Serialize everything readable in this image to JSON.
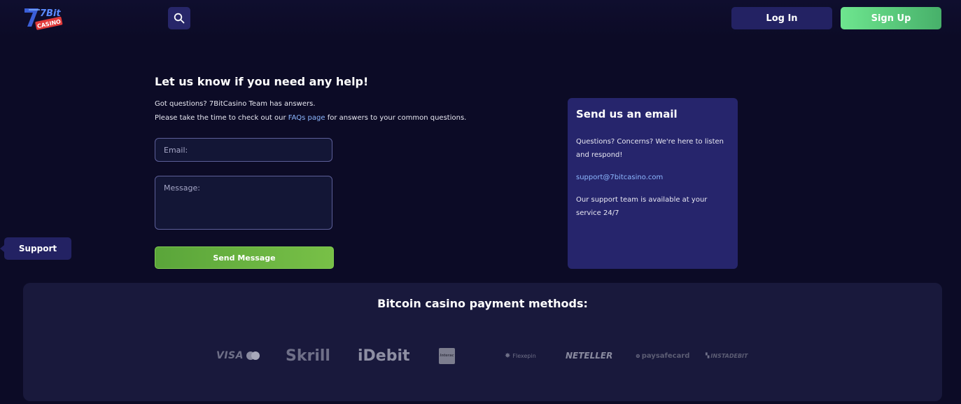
{
  "header": {
    "logo": {
      "text_top": "7Bit",
      "text_bottom": "CASINO",
      "icon": "7bit-casino-logo-icon"
    },
    "search_icon": "search-icon",
    "login_label": "Log In",
    "signup_label": "Sign Up"
  },
  "help": {
    "title": "Let us know if you need any help!",
    "line1": "Got questions? 7BitCasino Team has answers.",
    "line2_prefix": "Please take the time to check out our ",
    "faq_link": "FAQs page",
    "line2_suffix": " for answers to your common questions."
  },
  "form": {
    "email_placeholder": "Email:",
    "message_placeholder": "Message:",
    "send_label": "Send Message"
  },
  "support_tab": {
    "label": "Support"
  },
  "email_card": {
    "title": "Send us an email",
    "text1": "Questions? Concerns? We're here to listen and respond!",
    "email": "support@7bitcasino.com",
    "text2": "Our support team is available at your service 24/7"
  },
  "payments": {
    "title": "Bitcoin casino payment methods:",
    "methods": [
      {
        "name": "VISA",
        "icon": "visa-mastercard-icon"
      },
      {
        "name": "Skrill",
        "icon": "skrill-icon"
      },
      {
        "name": "iDebit",
        "icon": "idebit-icon"
      },
      {
        "name": "Interac",
        "icon": "interac-icon"
      },
      {
        "name": "Flexepin",
        "icon": "flexepin-icon"
      },
      {
        "name": "NETELLER",
        "icon": "neteller-icon"
      },
      {
        "name": "paysafecard",
        "icon": "paysafecard-icon"
      },
      {
        "name": "INSTADEBIT",
        "icon": "instadebit-icon"
      }
    ]
  },
  "colors": {
    "background": "#0c0b26",
    "accent": "#26256c",
    "signup": "#6ee68f",
    "send": "#6bb541",
    "link": "#8db8ff"
  }
}
